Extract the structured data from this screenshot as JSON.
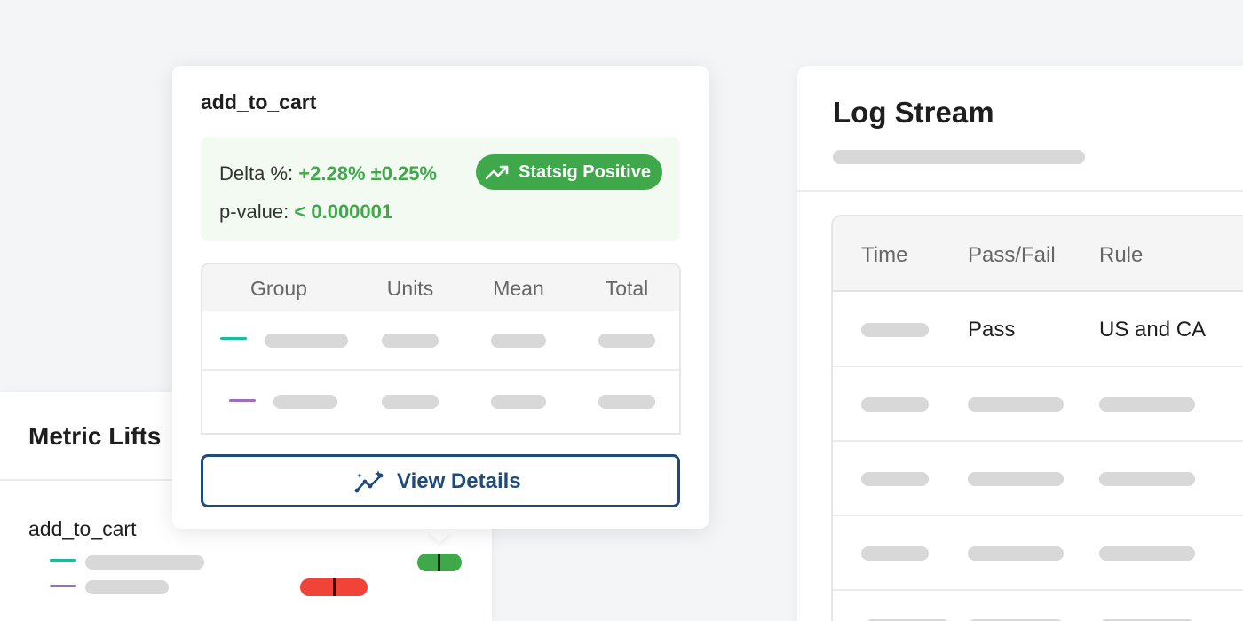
{
  "colors": {
    "positive": "#3fa84a",
    "negative": "#f04438",
    "control": "#1abc9c",
    "test": "#9b6fc0",
    "button": "#1e4b7a"
  },
  "metric_lifts": {
    "title": "Metric Lifts",
    "metric_name": "add_to_cart",
    "rows": [
      {
        "series": "control",
        "lift": "positive"
      },
      {
        "series": "test",
        "lift": "negative"
      }
    ]
  },
  "popover": {
    "title": "add_to_cart",
    "delta_label": "Delta %:",
    "delta_value": "+2.28% ±0.25%",
    "badge": {
      "icon": "trending-up-icon",
      "label": "Statsig Positive"
    },
    "pvalue_label": "p-value:",
    "pvalue_value": "< 0.000001",
    "table": {
      "columns": [
        "Group",
        "Units",
        "Mean",
        "Total"
      ]
    },
    "button": {
      "icon": "sparkle-chart-icon",
      "label": "View Details"
    }
  },
  "log_stream": {
    "title": "Log Stream",
    "columns": [
      "Time",
      "Pass/Fail",
      "Rule"
    ],
    "rows": [
      {
        "pass_fail": "Pass",
        "rule": "US and CA"
      }
    ]
  }
}
